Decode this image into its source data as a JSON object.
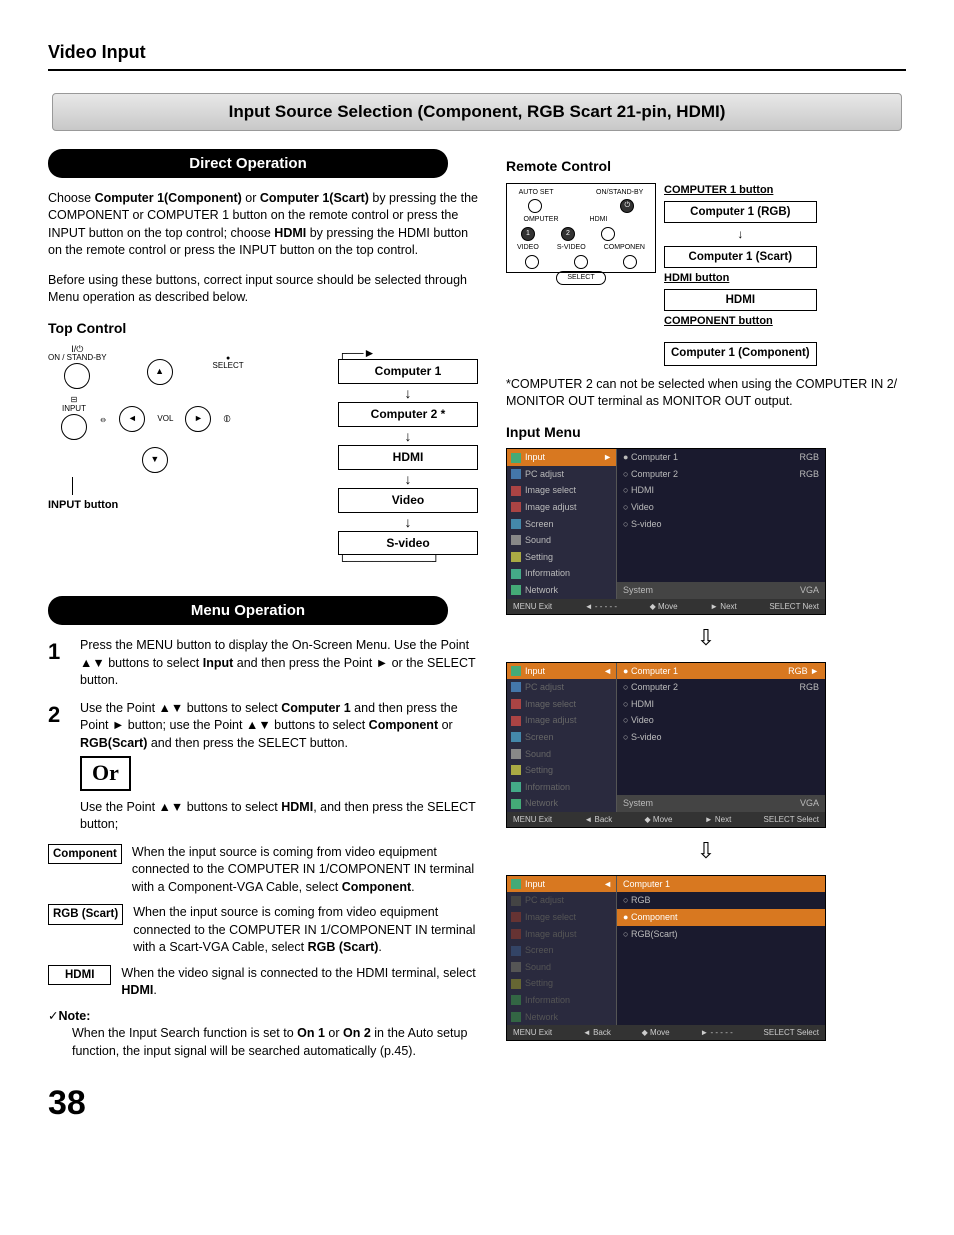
{
  "header": "Video Input",
  "banner": "Input Source Selection (Component, RGB Scart 21-pin, HDMI)",
  "directOperation": {
    "title": "Direct Operation",
    "para1_a": "Choose ",
    "para1_b1": "Computer 1(Component)",
    "para1_c": " or ",
    "para1_b2": "Computer 1(Scart)",
    "para1_d": " by pressing the the COMPONENT or COMPUTER 1 button on the remote control or press the INPUT button on the top control; choose ",
    "para1_b3": "HDMI",
    "para1_e": " by pressing the HDMI button on the remote control or press the INPUT button on the top control.",
    "para2": "Before using these buttons, correct input source should be selected through Menu operation as described below."
  },
  "topControl": {
    "title": "Top Control",
    "onStandby": "ON / STAND-BY",
    "select": "SELECT",
    "input": "INPUT",
    "vol": "VOL",
    "inputButtonLabel": "INPUT button",
    "flow": [
      "Computer 1",
      "Computer 2 *",
      "HDMI",
      "Video",
      "S-video"
    ]
  },
  "menuOperation": {
    "title": "Menu Operation",
    "step1_a": "Press the MENU button to display the On-Screen Menu. Use the Point ▲▼ buttons to select ",
    "step1_b": "Input",
    "step1_c": " and then press the Point ► or the SELECT button.",
    "step2_a": "Use the Point ▲▼ buttons to select ",
    "step2_b1": "Computer 1",
    "step2_c": " and then press the Point ► button; use the Point ▲▼ buttons to select ",
    "step2_b2": "Component",
    "step2_d": " or ",
    "step2_b3": "RGB(Scart)",
    "step2_e": " and then press the SELECT button.",
    "or": "Or",
    "after_or_a": "Use the Point ▲▼ buttons to select ",
    "after_or_b": "HDMI",
    "after_or_c": ", and then press the SELECT button;",
    "defs": [
      {
        "term": "Component",
        "body_a": "When the input source is coming from video equipment connected to the COMPUTER IN 1/COMPONENT IN terminal with a Component-VGA Cable, select ",
        "body_b": "Component",
        "body_c": "."
      },
      {
        "term": "RGB (Scart)",
        "body_a": "When the input source is coming from video equipment connected to the COMPUTER IN 1/COMPONENT IN terminal with a Scart-VGA Cable, select ",
        "body_b": "RGB (Scart)",
        "body_c": "."
      },
      {
        "term": "HDMI",
        "body_a": "When the video signal is connected to the HDMI terminal, select ",
        "body_b": "HDMI",
        "body_c": "."
      }
    ],
    "note_title": "Note:",
    "note_body_a": "When the Input Search function is set to ",
    "note_b1": "On 1",
    "note_mid": " or ",
    "note_b2": "On 2",
    "note_body_b": " in the Auto setup function, the input signal will be searched automatically (p.45)."
  },
  "remote": {
    "title": "Remote Control",
    "autoset": "AUTO SET",
    "onstandby": "ON/STAND-BY",
    "computer": "OMPUTER",
    "hdmi_s": "HDMI",
    "video": "VIDEO",
    "svideo": "S-VIDEO",
    "component_s": "COMPONEN",
    "select": "SELECT",
    "labels": {
      "comp1btn": "COMPUTER 1 button",
      "comp1rgb": "Computer 1 (RGB)",
      "comp1scart": "Computer 1 (Scart)",
      "hdmibtn": "HDMI button",
      "hdmi": "HDMI",
      "componentbtn": "COMPONENT button",
      "comp1component": "Computer 1 (Component)"
    },
    "footnote": "*COMPUTER 2 can not be selected when using the COMPUTER IN 2/ MONITOR OUT terminal as MONITOR OUT output."
  },
  "inputMenu": {
    "title": "Input Menu",
    "leftItems": [
      "Input",
      "PC adjust",
      "Image select",
      "Image adjust",
      "Screen",
      "Sound",
      "Setting",
      "Information",
      "Network"
    ],
    "screen1_right": [
      {
        "l": "Computer 1",
        "r": "RGB",
        "sel": false,
        "dot": "●"
      },
      {
        "l": "Computer 2",
        "r": "RGB",
        "sel": false,
        "dot": "○"
      },
      {
        "l": "HDMI",
        "r": "",
        "sel": false,
        "dot": "○"
      },
      {
        "l": "Video",
        "r": "",
        "sel": false,
        "dot": "○"
      },
      {
        "l": "S-video",
        "r": "",
        "sel": false,
        "dot": "○"
      }
    ],
    "screen2_right": [
      {
        "l": "Computer 1",
        "r": "RGB  ►",
        "sel": true,
        "dot": "●"
      },
      {
        "l": "Computer 2",
        "r": "RGB",
        "sel": false,
        "dot": "○"
      },
      {
        "l": "HDMI",
        "r": "",
        "sel": false,
        "dot": "○"
      },
      {
        "l": "Video",
        "r": "",
        "sel": false,
        "dot": "○"
      },
      {
        "l": "S-video",
        "r": "",
        "sel": false,
        "dot": "○"
      }
    ],
    "screen3_right": [
      {
        "l": "Computer 1",
        "r": "",
        "sel": true,
        "dot": ""
      },
      {
        "l": "RGB",
        "r": "",
        "sel": false,
        "dot": "○"
      },
      {
        "l": "Component",
        "r": "",
        "sel": true,
        "dot": "●"
      },
      {
        "l": "RGB(Scart)",
        "r": "",
        "sel": false,
        "dot": "○"
      }
    ],
    "sys_l": "System",
    "sys_r": "VGA",
    "foot1": {
      "exit": "MENU Exit",
      "back": "◄ - - - - -",
      "move": "◆ Move",
      "next": "► Next",
      "sel": "SELECT Next"
    },
    "foot2": {
      "exit": "MENU Exit",
      "back": "◄ Back",
      "move": "◆ Move",
      "next": "► Next",
      "sel": "SELECT Select"
    },
    "foot3": {
      "exit": "MENU Exit",
      "back": "◄ Back",
      "move": "◆ Move",
      "next": "► - - - - -",
      "sel": "SELECT Select"
    }
  },
  "pageNumber": "38"
}
